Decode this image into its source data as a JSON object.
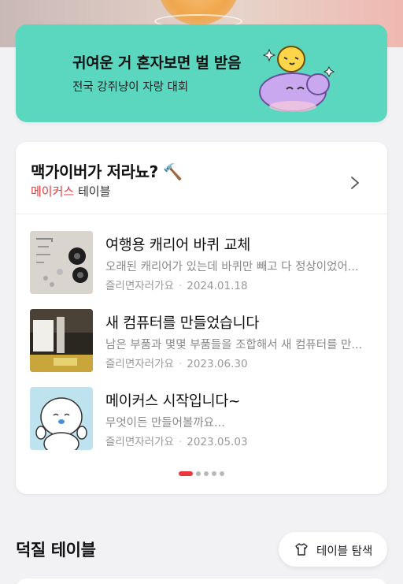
{
  "banner": {
    "title": "귀여운 거 혼자보면 벌 받음",
    "subtitle": "전국 강쥐냥이 자랑 대회",
    "accent": "#5bd6bf"
  },
  "card": {
    "title": "맥가이버가 저라뇨? 🔨",
    "brand": "메이커스",
    "brand_suffix": " 테이블",
    "brand_color": "#e8383d",
    "posts": [
      {
        "title": "여행용 캐리어 바퀴 교체",
        "snippet": "오래된 캐리어가 있는데 바퀴만 빼고 다 정상이었어...",
        "author": "즐리면자러가요",
        "date": "2024.01.18",
        "thumb": "wheel-parts-photo"
      },
      {
        "title": "새 컴퓨터를 만들었습니다",
        "snippet": "남은 부품과 몇몇 부품들을 조합해서 새 컴퓨터를 만...",
        "author": "즐리면자러가요",
        "date": "2023.06.30",
        "thumb": "computer-parts-photo"
      },
      {
        "title": "메이커스 시작입니다~",
        "snippet": "무엇이든 만들어볼까요...",
        "author": "즐리면자러가요",
        "date": "2023.05.03",
        "thumb": "character-illustration"
      }
    ],
    "pager": {
      "total": 5,
      "active": 1
    }
  },
  "section": {
    "title": "덕질 테이블",
    "explore_label": "테이블 탐색"
  }
}
